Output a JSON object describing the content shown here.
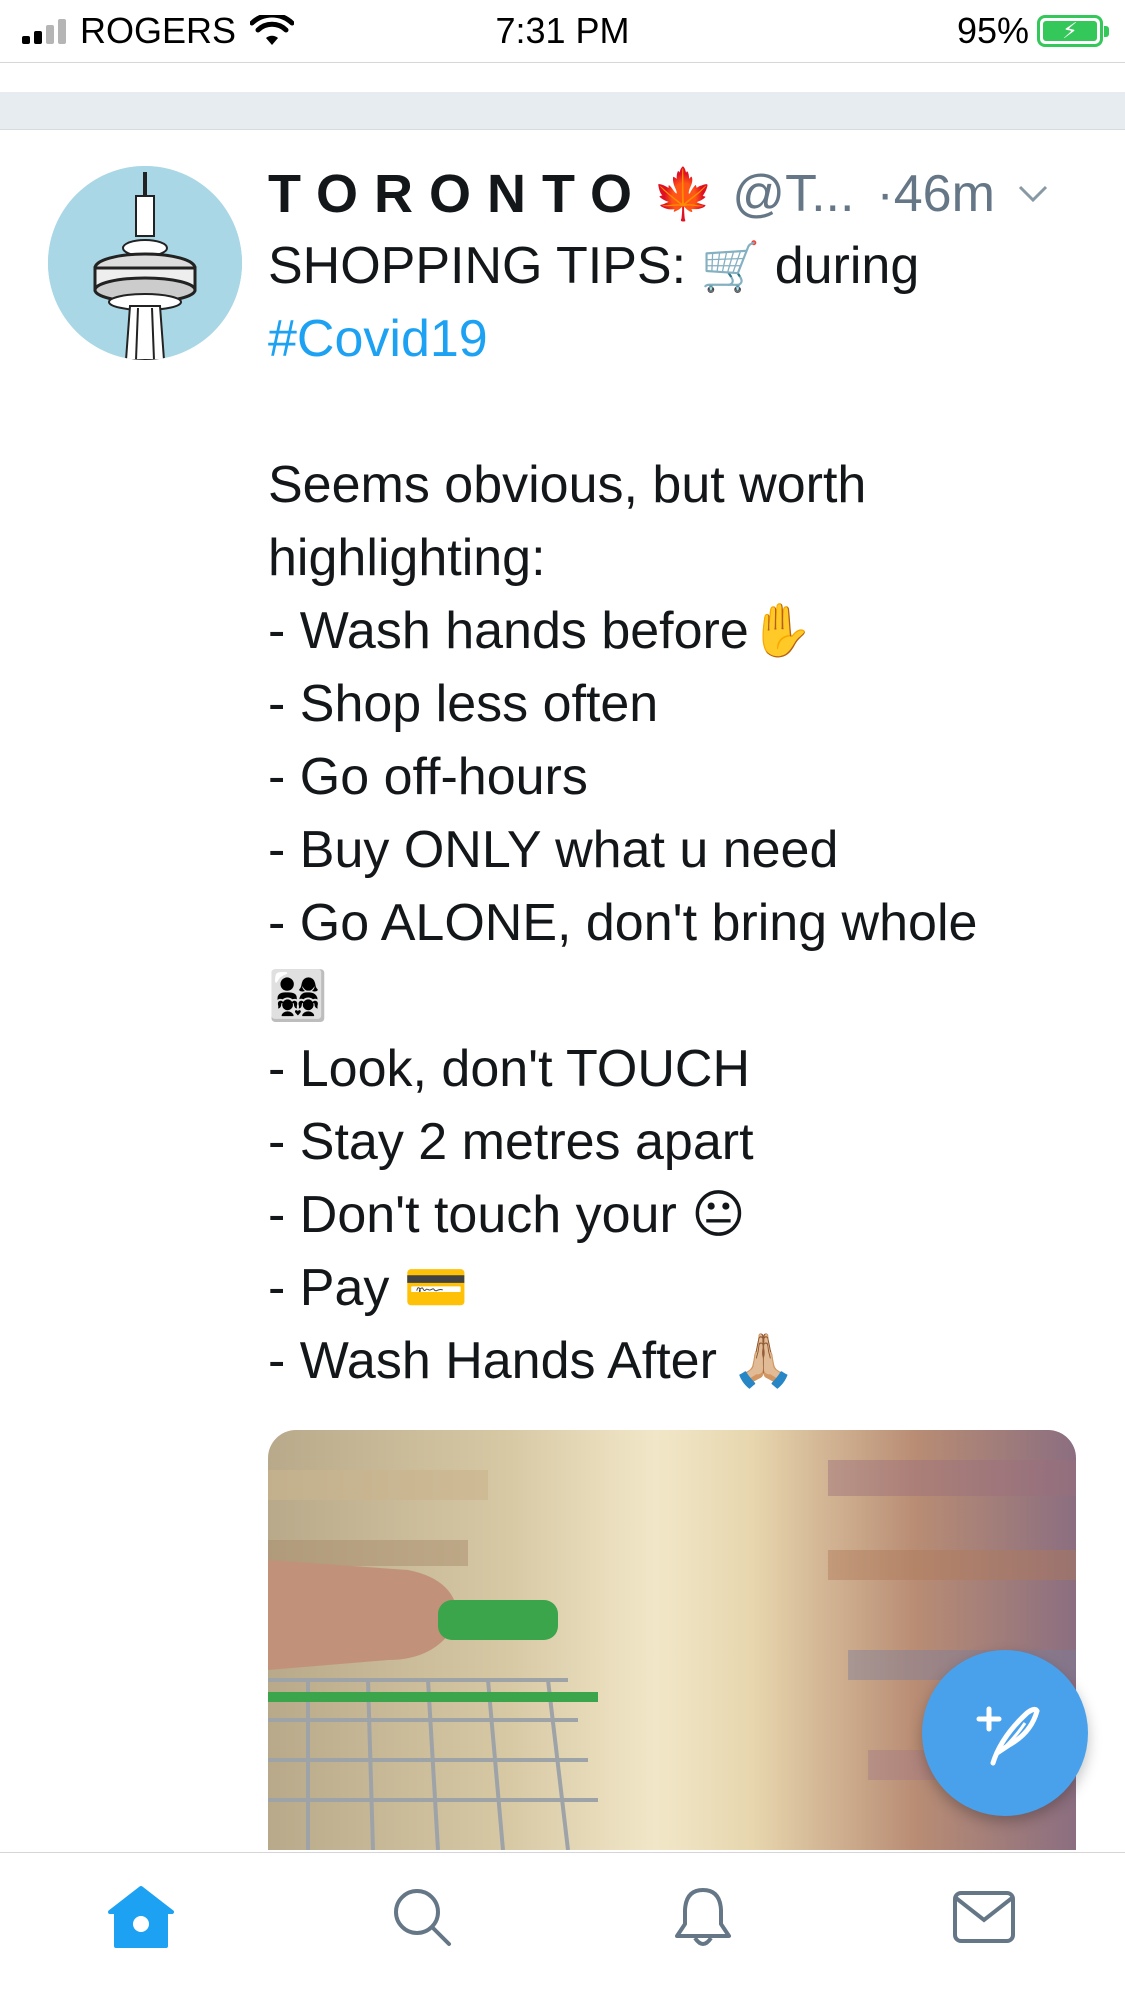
{
  "status_bar": {
    "carrier": "ROGERS",
    "time": "7:31 PM",
    "battery": "95%"
  },
  "tweet": {
    "display_name": "TORONTO",
    "flag_emoji": "🍁",
    "handle": "@T...",
    "timestamp": "·46m",
    "body": {
      "line1_text": "SHOPPING TIPS: ",
      "line1_emoji": "🛒",
      "line1_suffix": " during",
      "hashtag": "#Covid19",
      "lines": [
        "Seems obvious, but worth",
        "highlighting:",
        "- Wash hands before✋",
        "- Shop less often",
        "- Go off-hours",
        "- Buy ONLY what u need",
        "- Go ALONE, don't bring whole",
        "👨‍👩‍👧‍👧",
        "- Look, don't TOUCH",
        "- Stay 2 metres apart",
        "- Don't touch your 😐",
        "- Pay 💳",
        "- Wash Hands After 🙏🏼"
      ]
    }
  },
  "icons": {
    "avatar": "cn-tower-avatar-icon",
    "chevron": "chevron-down-icon",
    "compose": "compose-tweet-icon",
    "home": "home-icon",
    "search": "search-icon",
    "notifications": "bell-icon",
    "messages": "mail-icon"
  },
  "colors": {
    "accent": "#1da1f2",
    "fab": "#4aa1eb",
    "secondary_text": "#657786"
  }
}
